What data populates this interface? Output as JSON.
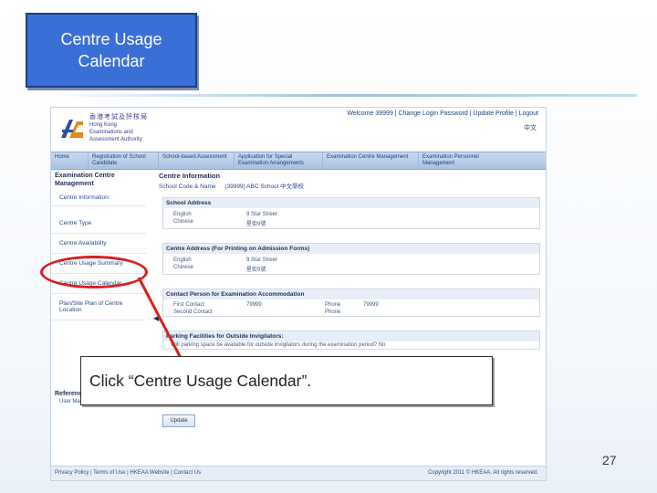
{
  "slide": {
    "title_line1": "Centre Usage",
    "title_line2": "Calendar",
    "page_number": "27",
    "callout_text": "Click “Centre Usage Calendar”."
  },
  "screenshot": {
    "logo_cn": "香港考試及評核局",
    "logo_en_line1": "Hong Kong",
    "logo_en_line2": "Examinations and",
    "logo_en_line3": "Assessment Authority",
    "welcome": "Welcome 39999 | Change Login Password | Update Profile | Logout",
    "lang": "中文",
    "nav": [
      "Home",
      "Registration of School Candidate",
      "School-based Assessment",
      "Application for Special Examination Arrangements",
      "Examination Centre Management",
      "Examination Personnel Management"
    ],
    "sidebar_head": "Examination Centre Management",
    "sidebar_items": [
      "Centre Information",
      "Centre Type",
      "Centre Availability",
      "Centre Usage Summary",
      "Centre Usage Calendar",
      "Plan/Site Plan of Centre Location"
    ],
    "reference_head": "Reference Document",
    "reference_item": "User Manual",
    "main_head": "Centre Information",
    "school_code_label": "School Code & Name",
    "school_code_value": "(39999)   ABC School   中文學校",
    "school_address_head": "School Address",
    "centre_address_head": "Centre Address (For Printing on Admission Forms)",
    "address_rows": [
      {
        "label": "English",
        "value": "9 Star Street"
      },
      {
        "label": "Chinese",
        "value": "星街9號"
      }
    ],
    "contact_head": "Contact Person for Examination Accommodation",
    "contact_rows": [
      {
        "label": "First Contact",
        "value": "79999",
        "label2": "Phone",
        "value2": "79999"
      },
      {
        "label": "Second Contact",
        "value": "",
        "label2": "Phone",
        "value2": ""
      }
    ],
    "parking_head": "Parking Facilities for Outside Invigilators:",
    "parking_text": "Will parking space be available for outside invigilators during the examination period? No",
    "update_label": "Update",
    "footer_links": "Privacy Policy | Terms of Use | HKEAA Website | Contact Us",
    "copyright": "Copyright 2011 © HKEAA. All rights reserved."
  },
  "colors": {
    "title_box": "#3a6fd6",
    "callout_outline": "#d62020"
  }
}
